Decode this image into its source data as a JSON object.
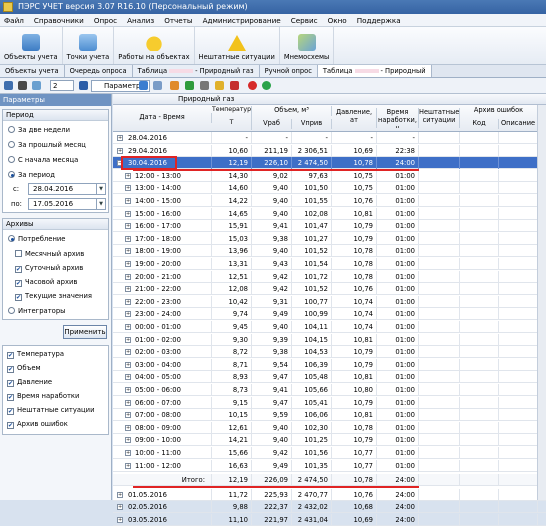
{
  "window": {
    "title": "ПЭРС УЧЕТ версия 3.07 R16.10 (Персональный режим)"
  },
  "menu": [
    "Файл",
    "Справочники",
    "Опрос",
    "Анализ",
    "Отчеты",
    "Администрирование",
    "Сервис",
    "Окно",
    "Поддержка"
  ],
  "ribbon": {
    "buttons": [
      {
        "label": "Объекты учета",
        "icon": "objects-icon"
      },
      {
        "label": "Точки учета",
        "icon": "points-icon"
      },
      {
        "label": "Работы на объектах",
        "icon": "helmet-icon"
      },
      {
        "label": "Нештатные ситуации",
        "icon": "warning-icon"
      },
      {
        "label": "Мнемосхемы",
        "icon": "map-pin-icon"
      }
    ]
  },
  "doctabs": [
    {
      "label": "Объекты учета",
      "active": false
    },
    {
      "label": "Очередь опроса",
      "active": false
    },
    {
      "label": "Таблица",
      "suffix": "- Природный газ",
      "active": false
    },
    {
      "label": "Ручной опрос",
      "active": false
    },
    {
      "label": "Таблица",
      "suffix": "- Природный",
      "active": true
    }
  ],
  "toolbar": {
    "page_number": "2",
    "params_label": "Параметры"
  },
  "left_panel": {
    "header": "Параметры",
    "period": {
      "title": "Период",
      "options": [
        {
          "label": "За две недели",
          "selected": false
        },
        {
          "label": "За прошлый месяц",
          "selected": false
        },
        {
          "label": "С начала месяца",
          "selected": false
        },
        {
          "label": "За период",
          "selected": true
        }
      ],
      "from_label": "с:",
      "from_value": "28.04.2016",
      "to_label": "по:",
      "to_value": "17.05.2016"
    },
    "archives": {
      "title": "Архивы",
      "consumption_label": "Потребление",
      "items": [
        {
          "label": "Месячный архив",
          "checked": false
        },
        {
          "label": "Суточный архив",
          "checked": true
        },
        {
          "label": "Часовой архив",
          "checked": true
        },
        {
          "label": "Текущие значения",
          "checked": true
        }
      ],
      "integrators_label": "Интеграторы"
    },
    "apply_label": "Применить",
    "tree": [
      "Температура",
      "Объем",
      "Давление",
      "Время наработки",
      "Нештатные ситуации",
      "Архив ошибок"
    ]
  },
  "table": {
    "title": "Природный газ",
    "headers": {
      "datetime": "Дата - Время",
      "temp": "Температура",
      "temp_sub": "T",
      "volume": "Объем, м³",
      "vrab": "Vраб",
      "vpriv": "Vприв",
      "pressure": "Давление, ат",
      "runtime": "Время наработки, ч",
      "faults": "Нештатные ситуации",
      "errors": "Архив ошибок",
      "code": "Код",
      "desc": "Описание"
    },
    "rows": [
      {
        "dt": "28.04.2016",
        "t": "-",
        "vrab": "-",
        "vpriv": "-",
        "p": "-",
        "h": "-",
        "type": "day"
      },
      {
        "dt": "29.04.2016",
        "t": "10,60",
        "vrab": "211,19",
        "vpriv": "2 306,51",
        "p": "10,69",
        "h": "22:38",
        "type": "day"
      },
      {
        "dt": "30.04.2016",
        "t": "12,19",
        "vrab": "226,10",
        "vpriv": "2 474,50",
        "p": "10,78",
        "h": "24:00",
        "type": "day",
        "selected": true
      },
      {
        "dt": "12:00 - 13:00",
        "t": "14,30",
        "vrab": "9,02",
        "vpriv": "97,63",
        "p": "10,75",
        "h": "01:00",
        "type": "hour"
      },
      {
        "dt": "13:00 - 14:00",
        "t": "14,60",
        "vrab": "9,40",
        "vpriv": "101,50",
        "p": "10,75",
        "h": "01:00",
        "type": "hour"
      },
      {
        "dt": "14:00 - 15:00",
        "t": "14,22",
        "vrab": "9,40",
        "vpriv": "101,55",
        "p": "10,76",
        "h": "01:00",
        "type": "hour"
      },
      {
        "dt": "15:00 - 16:00",
        "t": "14,65",
        "vrab": "9,40",
        "vpriv": "102,08",
        "p": "10,81",
        "h": "01:00",
        "type": "hour"
      },
      {
        "dt": "16:00 - 17:00",
        "t": "15,91",
        "vrab": "9,41",
        "vpriv": "101,47",
        "t2": "",
        "p": "10,79",
        "h": "01:00",
        "type": "hour"
      },
      {
        "dt": "17:00 - 18:00",
        "t": "15,03",
        "vrab": "9,38",
        "vpriv": "101,27",
        "p": "10,79",
        "h": "01:00",
        "type": "hour"
      },
      {
        "dt": "18:00 - 19:00",
        "t": "13,96",
        "vrab": "9,40",
        "vpriv": "101,52",
        "p": "10,78",
        "h": "01:00",
        "type": "hour"
      },
      {
        "dt": "19:00 - 20:00",
        "t": "13,31",
        "vrab": "9,43",
        "vpriv": "101,54",
        "p": "10,78",
        "h": "01:00",
        "type": "hour"
      },
      {
        "dt": "20:00 - 21:00",
        "t": "12,51",
        "vrab": "9,42",
        "vpriv": "101,72",
        "p": "10,78",
        "h": "01:00",
        "type": "hour"
      },
      {
        "dt": "21:00 - 22:00",
        "t": "12,08",
        "vrab": "9,42",
        "vpriv": "101,52",
        "p": "10,76",
        "h": "01:00",
        "type": "hour"
      },
      {
        "dt": "22:00 - 23:00",
        "t": "10,42",
        "vrab": "9,31",
        "vpriv": "100,77",
        "p": "10,74",
        "h": "01:00",
        "type": "hour"
      },
      {
        "dt": "23:00 - 24:00",
        "t": "9,74",
        "vrab": "9,49",
        "vpriv": "100,99",
        "p": "10,74",
        "h": "01:00",
        "type": "hour"
      },
      {
        "dt": "00:00 - 01:00",
        "t": "9,45",
        "vrab": "9,40",
        "vpriv": "104,11",
        "p": "10,74",
        "h": "01:00",
        "type": "hour"
      },
      {
        "dt": "01:00 - 02:00",
        "t": "9,30",
        "vrab": "9,39",
        "vpriv": "104,15",
        "p": "10,81",
        "h": "01:00",
        "type": "hour"
      },
      {
        "dt": "02:00 - 03:00",
        "t": "8,72",
        "vrab": "9,38",
        "vpriv": "104,53",
        "p": "10,79",
        "h": "01:00",
        "type": "hour"
      },
      {
        "dt": "03:00 - 04:00",
        "t": "8,71",
        "vrab": "9,54",
        "vpriv": "106,39",
        "p": "10,79",
        "h": "01:00",
        "type": "hour"
      },
      {
        "dt": "04:00 - 05:00",
        "t": "8,93",
        "vrab": "9,47",
        "vpriv": "105,48",
        "p": "10,81",
        "h": "01:00",
        "type": "hour"
      },
      {
        "dt": "05:00 - 06:00",
        "t": "8,73",
        "vrab": "9,41",
        "vpriv": "105,66",
        "p": "10,80",
        "h": "01:00",
        "type": "hour"
      },
      {
        "dt": "06:00 - 07:00",
        "t": "9,15",
        "vrab": "9,47",
        "vpriv": "105,41",
        "p": "10,79",
        "h": "01:00",
        "type": "hour"
      },
      {
        "dt": "07:00 - 08:00",
        "t": "10,15",
        "vrab": "9,59",
        "vpriv": "106,06",
        "p": "10,81",
        "h": "01:00",
        "type": "hour"
      },
      {
        "dt": "08:00 - 09:00",
        "t": "12,61",
        "vrab": "9,40",
        "vpriv": "102,30",
        "p": "10,78",
        "h": "01:00",
        "type": "hour"
      },
      {
        "dt": "09:00 - 10:00",
        "t": "14,21",
        "vrab": "9,40",
        "vpriv": "101,25",
        "p": "10,79",
        "h": "01:00",
        "type": "hour"
      },
      {
        "dt": "10:00 - 11:00",
        "t": "15,66",
        "vrab": "9,42",
        "vpriv": "101,56",
        "p": "10,77",
        "h": "01:00",
        "type": "hour"
      },
      {
        "dt": "11:00 - 12:00",
        "t": "16,63",
        "vrab": "9,49",
        "vpriv": "101,35",
        "p": "10,77",
        "h": "01:00",
        "type": "hour"
      }
    ],
    "total": {
      "label": "Итого:",
      "t": "12,19",
      "vrab": "226,09",
      "vpriv": "2 474,50",
      "p": "10,78",
      "h": "24:00"
    },
    "after_rows": [
      {
        "dt": "01.05.2016",
        "t": "11,72",
        "vrab": "225,93",
        "vpriv": "2 470,77",
        "p": "10,76",
        "h": "24:00"
      },
      {
        "dt": "02.05.2016",
        "t": "9,88",
        "vrab": "222,37",
        "vpriv": "2 432,02",
        "p": "10,68",
        "h": "24:00"
      },
      {
        "dt": "03.05.2016",
        "t": "11,10",
        "vrab": "221,97",
        "vpriv": "2 431,04",
        "p": "10,69",
        "h": "24:00"
      }
    ]
  }
}
